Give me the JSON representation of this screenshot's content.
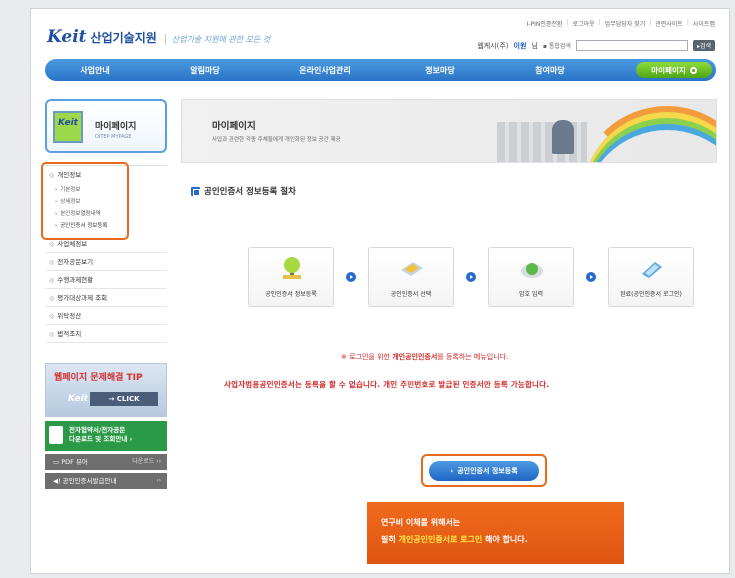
{
  "brand": {
    "mark": "Keit",
    "name": "산업기술지원",
    "slogan": "산업기술 지원에 관한 모든 것"
  },
  "util_nav": [
    "I-PIN인증전환",
    "로그아웃",
    "업무담당자 찾기",
    "관련사이트",
    "사이트맵"
  ],
  "user": {
    "label_pre": "웹케시(주)",
    "name": "이원",
    "label_post": "님",
    "search_label": "▪ 통합검색",
    "search_placeholder": "",
    "search_button": "▸검색"
  },
  "gnb": {
    "items": [
      "사업안내",
      "알림마당",
      "온라인사업관리",
      "정보마당",
      "참여마당"
    ],
    "mypage": "마이페이지"
  },
  "sidebar": {
    "title": "마이페이지",
    "subtitle": "DITEP MYPAGE",
    "icon_text": "Keit",
    "group": {
      "label": "개인정보",
      "subs": [
        "기본정보",
        "상세정보",
        "본인정보열람내역",
        "공인인증서 정보등록"
      ]
    },
    "menu": [
      "사업체정보",
      "전자공문보기",
      "수행과제현황",
      "평가대상과제 조회",
      "위탁정산",
      "법적조치"
    ],
    "banner_tip": "웹페이지 문제해결 TIP",
    "banner_tip_click": "→ CLICK",
    "banner_tip_logo": "Keit",
    "banner_doc": [
      "전자협약서/전자공문",
      "다운로드 및 조회안내 ›"
    ],
    "banner_pdf": "PDF 뷰어",
    "banner_pdf_r": "다운로드 ››",
    "banner_cert": "◀) 공인인증서발급안내",
    "banner_cert_r": "››"
  },
  "hero": {
    "title": "마이페이지",
    "subtitle": "사업과 관련한 각종 주체들에게 개인화된 정보 공간 제공"
  },
  "section_title": "공인인증서 정보등록 절차",
  "steps": [
    "공인인증서 정보등록",
    "공인인증서 선택",
    "암호 입력",
    "완료(공인인증서 로그인)"
  ],
  "note1": {
    "pre": "※ 로그인을 위한 ",
    "bold": "개인공인인증서",
    "post": "를 등록하는 메뉴입니다."
  },
  "note2": "사업자범용공인인증서는 등록을 할 수 없습니다. 개인 주민번호로 발급된 인증서만 등록 가능합니다.",
  "register_button": "공인인증서 정보등록",
  "warning": {
    "line1": "연구비 이체를 위해서는",
    "l2_pre": "필히 ",
    "l2_hl": "개인공인인증서로 로그인",
    "l2_post": " 해야 합니다."
  }
}
